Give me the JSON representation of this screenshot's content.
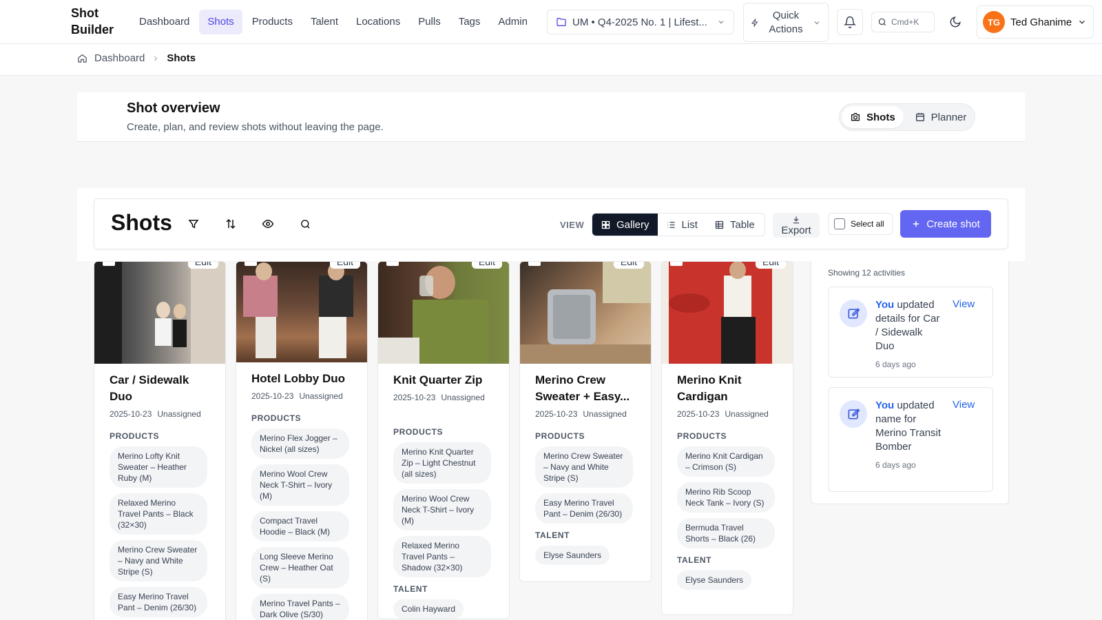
{
  "app": {
    "brand": "Shot Builder"
  },
  "nav": {
    "items": [
      "Dashboard",
      "Shots",
      "Products",
      "Talent",
      "Locations",
      "Pulls",
      "Tags",
      "Admin"
    ],
    "active": "Shots"
  },
  "project": {
    "label": "UM • Q4-2025 No. 1 | Lifest..."
  },
  "quick_actions": {
    "label": "Quick Actions"
  },
  "search": {
    "shortcut": "Cmd+K"
  },
  "user": {
    "initials": "TG",
    "name": "Ted Ghanime"
  },
  "breadcrumb": {
    "home": "Dashboard",
    "current": "Shots"
  },
  "overview": {
    "title": "Shot overview",
    "subtitle": "Create, plan, and review shots without leaving the page.",
    "tabs": [
      "Shots",
      "Planner"
    ]
  },
  "toolbar": {
    "title": "Shots",
    "view_label": "VIEW",
    "views": [
      "Gallery",
      "List",
      "Table"
    ],
    "export": "Export",
    "select_all": "Select all",
    "create": "Create shot"
  },
  "card_labels": {
    "edit": "Edit",
    "products": "PRODUCTS",
    "talent": "TALENT"
  },
  "cards": [
    {
      "title": "Car / Sidewalk Duo",
      "date": "2025-10-23",
      "assignee": "Unassigned",
      "products": [
        "Merino Lofty Knit Sweater – Heather Ruby (M)",
        "Relaxed Merino Travel Pants – Black (32×30)",
        "Merino Crew Sweater – Navy and White Stripe (S)",
        "Easy Merino Travel Pant – Denim (26/30)"
      ],
      "talent": []
    },
    {
      "title": "Hotel Lobby Duo",
      "date": "2025-10-23",
      "assignee": "Unassigned",
      "products": [
        "Merino Flex Jogger – Nickel (all sizes)",
        "Merino Wool Crew Neck T-Shirt – Ivory (M)",
        "Compact Travel Hoodie – Black (M)",
        "Long Sleeve Merino Crew – Heather Oat (S)",
        "Merino Travel Pants – Dark Olive (S/30)"
      ],
      "talent": []
    },
    {
      "title": "Knit Quarter Zip",
      "date": "2025-10-23",
      "assignee": "Unassigned",
      "products": [
        "Merino Knit Quarter Zip – Light Chestnut (all sizes)",
        "Merino Wool Crew Neck T-Shirt – Ivory (M)",
        "Relaxed Merino Travel Pants – Shadow (32×30)"
      ],
      "talent": [
        "Colin Hayward"
      ]
    },
    {
      "title": "Merino Crew Sweater + Easy...",
      "date": "2025-10-23",
      "assignee": "Unassigned",
      "products": [
        "Merino Crew Sweater – Navy and White Stripe (S)",
        "Easy Merino Travel Pant – Denim (26/30)"
      ],
      "talent": [
        "Elyse Saunders"
      ]
    },
    {
      "title": "Merino Knit Cardigan",
      "date": "2025-10-23",
      "assignee": "Unassigned",
      "products": [
        "Merino Knit Cardigan – Crimson (S)",
        "Merino Rib Scoop Neck Tank – Ivory (S)",
        "Bermuda Travel Shorts – Black (26)"
      ],
      "talent": [
        "Elyse Saunders"
      ]
    }
  ],
  "activity": {
    "count_text": "Showing 12 activities",
    "items": [
      {
        "actor": "You",
        "text": "updated details for Car / Sidewalk Duo",
        "time": "6 days ago",
        "action": "View"
      },
      {
        "actor": "You",
        "text": "updated name for Merino Transit Bomber",
        "time": "6 days ago",
        "action": "View"
      }
    ]
  },
  "colors": {
    "accent": "#6366f1",
    "nav_active_bg": "#ecebfb",
    "link": "#2563eb",
    "avatar": "#f97316"
  }
}
